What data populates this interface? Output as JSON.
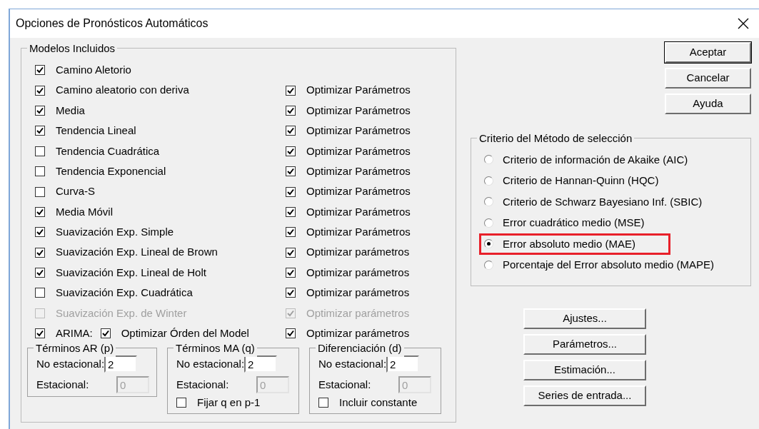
{
  "window": {
    "title": "Opciones de Pronósticos Automáticos"
  },
  "models_group": {
    "title": "Modelos Incluidos",
    "models": [
      {
        "kind": "model",
        "label": "Camino Aletorio",
        "checked": true,
        "disabled": false
      },
      {
        "kind": "model",
        "label": "Camino aleatorio con deriva",
        "checked": true,
        "disabled": false,
        "optimize": {
          "label": "Optimizar Parámetros",
          "checked": true,
          "disabled": false
        }
      },
      {
        "kind": "model",
        "label": "Media",
        "checked": true,
        "disabled": false,
        "optimize": {
          "label": "Optimizar Parámetros",
          "checked": true,
          "disabled": false
        }
      },
      {
        "kind": "model",
        "label": "Tendencia Lineal",
        "checked": true,
        "disabled": false,
        "optimize": {
          "label": "Optimizar Parámetros",
          "checked": true,
          "disabled": false
        }
      },
      {
        "kind": "model",
        "label": "Tendencia Cuadrática",
        "checked": false,
        "disabled": false,
        "optimize": {
          "label": "Optimizar Parámetros",
          "checked": true,
          "disabled": false
        }
      },
      {
        "kind": "model",
        "label": "Tendencia Exponencial",
        "checked": false,
        "disabled": false,
        "optimize": {
          "label": "Optimizar Parámetros",
          "checked": true,
          "disabled": false
        }
      },
      {
        "kind": "model",
        "label": "Curva-S",
        "checked": false,
        "disabled": false,
        "optimize": {
          "label": "Optimizar Parámetros",
          "checked": true,
          "disabled": false
        }
      },
      {
        "kind": "model",
        "label": "Media Móvil",
        "checked": true,
        "disabled": false,
        "optimize": {
          "label": "Optimizar Parámetros",
          "checked": true,
          "disabled": false
        }
      },
      {
        "kind": "model",
        "label": "Suavización Exp. Simple",
        "checked": true,
        "disabled": false,
        "optimize": {
          "label": "Optimizar Parámetros",
          "checked": true,
          "disabled": false
        }
      },
      {
        "kind": "model",
        "label": "Suavización Exp. Lineal de Brown",
        "checked": true,
        "disabled": false,
        "optimize": {
          "label": "Optimizar parámetros",
          "checked": true,
          "disabled": false
        }
      },
      {
        "kind": "model",
        "label": "Suavización Exp. Lineal de Holt",
        "checked": true,
        "disabled": false,
        "optimize": {
          "label": "Optimizar parámetros",
          "checked": true,
          "disabled": false
        }
      },
      {
        "kind": "model",
        "label": "Suavización Exp. Cuadrática",
        "checked": false,
        "disabled": false,
        "optimize": {
          "label": "Optimizar parámetros",
          "checked": true,
          "disabled": false
        }
      },
      {
        "kind": "model",
        "label": "Suavización Exp. de Winter",
        "checked": false,
        "disabled": true,
        "optimize": {
          "label": "Optimizar parámetros",
          "checked": true,
          "disabled": true
        }
      },
      {
        "kind": "arima",
        "label": "ARIMA:",
        "checked": true,
        "disabled": false,
        "order": {
          "label": "Optimizar Órden del Model",
          "checked": true
        },
        "optimize": {
          "label": "Optimizar parámetros",
          "checked": true,
          "disabled": false
        }
      }
    ]
  },
  "term_groups": [
    {
      "title": "Términos AR (p)",
      "nonseasonal_label": "No estacional:",
      "nonseasonal": "2",
      "seasonal_label": "Estacional:",
      "seasonal": "0",
      "seasonal_disabled": true
    },
    {
      "title": "Términos MA (q)",
      "nonseasonal_label": "No estacional:",
      "nonseasonal": "2",
      "seasonal_label": "Estacional:",
      "seasonal": "0",
      "seasonal_disabled": true,
      "option": {
        "label": "Fijar q en p-1",
        "checked": false
      }
    },
    {
      "title": "Diferenciación (d)",
      "nonseasonal_label": "No estacional:",
      "nonseasonal": "2",
      "seasonal_label": "Estacional:",
      "seasonal": "0",
      "seasonal_disabled": true,
      "option": {
        "label": "Incluir constante",
        "checked": false
      }
    }
  ],
  "dialog_buttons": [
    {
      "label": "Aceptar",
      "default": true
    },
    {
      "label": "Cancelar",
      "default": false
    },
    {
      "label": "Ayuda",
      "default": false
    }
  ],
  "criterion": {
    "title": "Criterio del Método de selección",
    "options": [
      {
        "label": "Criterio de información de Akaike (AIC)",
        "selected": false,
        "highlighted": false
      },
      {
        "label": "Criterio de Hannan-Quinn (HQC)",
        "selected": false,
        "highlighted": false
      },
      {
        "label": "Criterio de Schwarz Bayesiano Inf. (SBIC)",
        "selected": false,
        "highlighted": false
      },
      {
        "label": "Error cuadrático medio (MSE)",
        "selected": false,
        "highlighted": false
      },
      {
        "label": "Error absoluto medio (MAE)",
        "selected": true,
        "highlighted": true
      },
      {
        "label": "Porcentaje del Error absoluto medio (MAPE)",
        "selected": false,
        "highlighted": false
      }
    ]
  },
  "option_buttons": [
    "Ajustes...",
    "Parámetros...",
    "Estimación...",
    "Series de entrada..."
  ]
}
